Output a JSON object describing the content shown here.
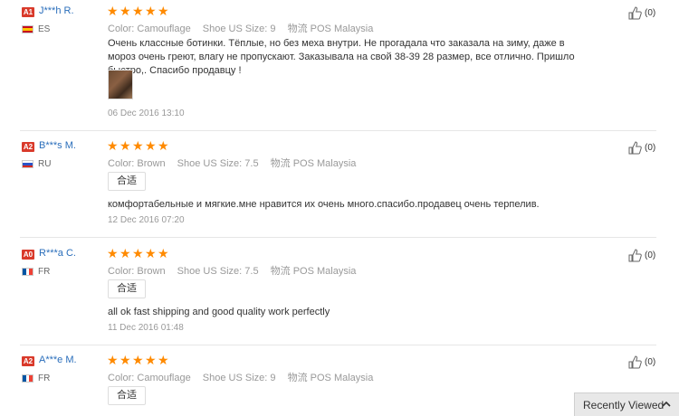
{
  "reviews": [
    {
      "level": "A1",
      "level_color": "#d93a2b",
      "user": "J***h R.",
      "country": "ES",
      "flag": "es",
      "rating": 5,
      "color_label": "Color:",
      "color": "Camouflage",
      "size_label": "Shoe US Size:",
      "size": "9",
      "ship_label": "物流",
      "ship": "POS Malaysia",
      "text": "Очень классные ботинки. Тёплые, но без меха внутри. Не прогадала что заказала на зиму, даже в мороз очень греют, влагу не пропускают. Заказывала на свой 38-39 28 размер, все отлично. Пришло быстро,. Спасибо продавцу !",
      "tag": "",
      "has_photo": true,
      "date": "06 Dec 2016 13:10",
      "likes": "(0)"
    },
    {
      "level": "A2",
      "level_color": "#d93a2b",
      "user": "B***s M.",
      "country": "RU",
      "flag": "ru",
      "rating": 5,
      "color_label": "Color:",
      "color": "Brown",
      "size_label": "Shoe US Size:",
      "size": "7.5",
      "ship_label": "物流",
      "ship": "POS Malaysia",
      "tag": "合适",
      "text": "комфортабельные и мягкие.мне нравится их очень много.спасибо.продавец очень терпелив.",
      "has_photo": false,
      "date": "12 Dec 2016 07:20",
      "likes": "(0)"
    },
    {
      "level": "A0",
      "level_color": "#d93a2b",
      "user": "R***a C.",
      "country": "FR",
      "flag": "fr",
      "rating": 5,
      "color_label": "Color:",
      "color": "Brown",
      "size_label": "Shoe US Size:",
      "size": "7.5",
      "ship_label": "物流",
      "ship": "POS Malaysia",
      "tag": "合适",
      "text": "all ok fast shipping and good quality work perfectly",
      "has_photo": false,
      "date": "11 Dec 2016 01:48",
      "likes": "(0)"
    },
    {
      "level": "A2",
      "level_color": "#d93a2b",
      "user": "A***e M.",
      "country": "FR",
      "flag": "fr",
      "rating": 5,
      "color_label": "Color:",
      "color": "Camouflage",
      "size_label": "Shoe US Size:",
      "size": "9",
      "ship_label": "物流",
      "ship": "POS Malaysia",
      "tag": "合适",
      "text": "",
      "has_photo": false,
      "date": "",
      "likes": "(0)"
    }
  ],
  "recently_viewed": "Recently Viewed",
  "colors": {
    "star": "#ff8a00",
    "user_link": "#2a6ebb",
    "badge": "#d93a2b"
  }
}
